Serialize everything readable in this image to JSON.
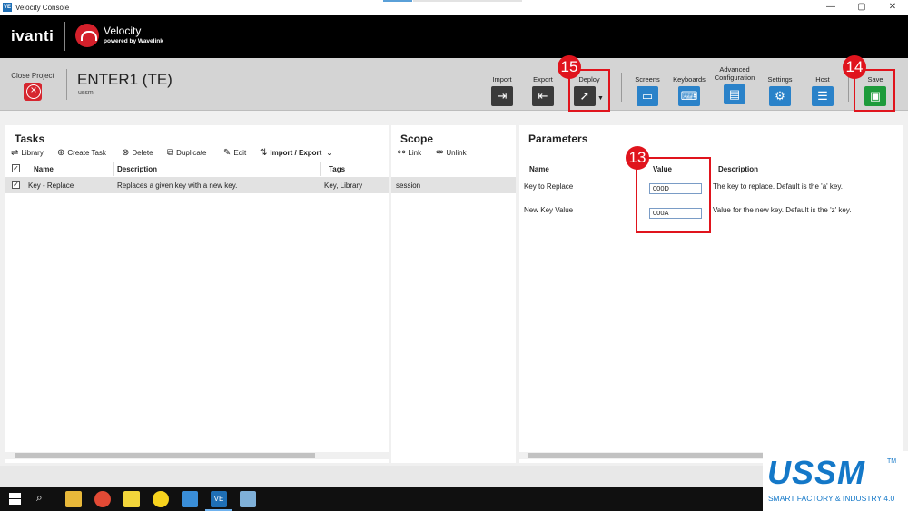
{
  "window": {
    "title": "Velocity Console",
    "app_icon": "VE",
    "minimize": "—",
    "maximize": "▢",
    "close": "✕"
  },
  "brand": {
    "company": "ivanti",
    "product": "Velocity",
    "tagline": "powered by Wavelink"
  },
  "toolbar": {
    "close_project": "Close Project",
    "project_name": "ENTER1 (TE)",
    "project_sub": "ussm",
    "import": "Import",
    "export": "Export",
    "deploy": "Deploy",
    "screens": "Screens",
    "keyboards": "Keyboards",
    "advanced_configuration": "Advanced\nConfiguration",
    "settings": "Settings",
    "host": "Host",
    "save": "Save"
  },
  "annotations": {
    "deploy_badge": "15",
    "save_badge": "14",
    "value_badge": "13"
  },
  "tasks": {
    "title": "Tasks",
    "actions": {
      "library": "Library",
      "create": "Create Task",
      "delete": "Delete",
      "duplicate": "Duplicate",
      "edit": "Edit",
      "import_export": "Import / Export"
    },
    "columns": {
      "name": "Name",
      "description": "Description",
      "tags": "Tags"
    },
    "rows": [
      {
        "checked": true,
        "name": "Key - Replace",
        "description": "Replaces a given key with a new key.",
        "tags": "Key, Library"
      }
    ]
  },
  "scope": {
    "title": "Scope",
    "actions": {
      "link": "Link",
      "unlink": "Unlink"
    },
    "rows": [
      "session"
    ]
  },
  "parameters": {
    "title": "Parameters",
    "columns": {
      "name": "Name",
      "value": "Value",
      "description": "Description"
    },
    "rows": [
      {
        "name": "Key to Replace",
        "value": "000D",
        "description": "The key to replace. Default is the 'a' key."
      },
      {
        "name": "New Key Value",
        "value": "000A",
        "description": "Value for the new key. Default is the 'z' key."
      }
    ]
  },
  "watermark": {
    "logo": "USSM",
    "tm": "TM",
    "tagline": "SMART FACTORY & INDUSTRY 4.0"
  },
  "colors": {
    "accent_red": "#e0141d",
    "toolbar_blue": "#2a82c9",
    "save_green": "#1e9b3b"
  }
}
